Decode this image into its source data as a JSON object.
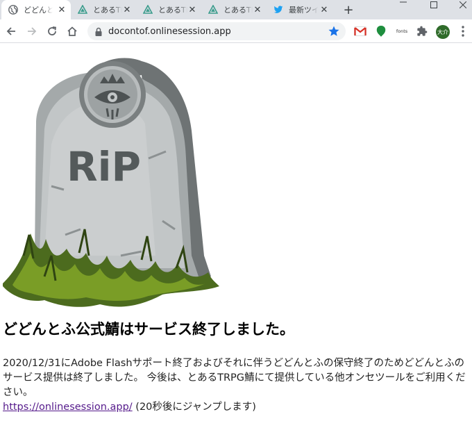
{
  "browser": {
    "tabs": [
      {
        "title": "どどんとふ",
        "icon": "globe-icon",
        "active": true
      },
      {
        "title": "とあるTR",
        "icon": "trpg-favicon-icon",
        "active": false
      },
      {
        "title": "とあるTR",
        "icon": "trpg-favicon-icon",
        "active": false
      },
      {
        "title": "とあるTR",
        "icon": "trpg-favicon-icon",
        "active": false
      },
      {
        "title": "最新ツイ",
        "icon": "twitter-icon",
        "active": false
      }
    ],
    "address_bar": {
      "url": "docontof.onlinesession.app"
    },
    "extensions": {
      "fonts_label": "fonts"
    },
    "profile": {
      "initials": "大介"
    }
  },
  "page": {
    "image": {
      "caption": "RiP"
    },
    "heading": "どどんとふ公式鯖はサービス終了しました。",
    "paragraph": "2020/12/31にAdobe Flashサポート終了およびそれに伴うどどんとふの保守終了のためどどんとふのサービス提供は終了しました。 今後は、とあるTRPG鯖にて提供している他オンセツールをご利用ください。",
    "link": {
      "text": "https://onlinesession.app/",
      "suffix": " (20秒後にジャンプします)"
    }
  },
  "colors": {
    "accent_link": "#551a8b",
    "tab_bg": "#dee1e6",
    "star": "#1a73e8"
  }
}
